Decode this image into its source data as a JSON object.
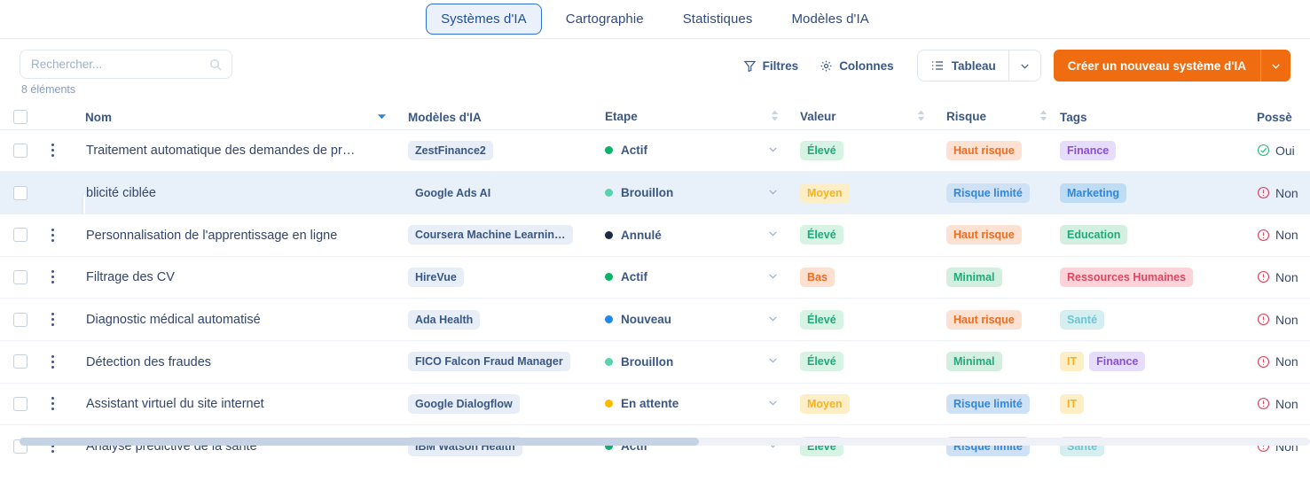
{
  "tabs": [
    {
      "label": "Systèmes d'IA",
      "active": true
    },
    {
      "label": "Cartographie",
      "active": false
    },
    {
      "label": "Statistiques",
      "active": false
    },
    {
      "label": "Modèles d'IA",
      "active": false
    }
  ],
  "toolbar": {
    "search_placeholder": "Rechercher...",
    "search_value": "",
    "count_label": "8 éléments",
    "filters_label": "Filtres",
    "columns_label": "Colonnes",
    "view_label": "Tableau",
    "create_label": "Créer un nouveau système d'IA",
    "accent_color": "#ef6c10"
  },
  "table": {
    "columns": [
      {
        "key": "nom",
        "label": "Nom",
        "sort": "desc"
      },
      {
        "key": "modeles",
        "label": "Modèles d'IA",
        "sort": "none"
      },
      {
        "key": "etape",
        "label": "Etape",
        "sort": "sortable"
      },
      {
        "key": "valeur",
        "label": "Valeur",
        "sort": "sortable"
      },
      {
        "key": "risque",
        "label": "Risque",
        "sort": "sortable"
      },
      {
        "key": "tags",
        "label": "Tags",
        "sort": "none"
      },
      {
        "key": "possede",
        "label": "Possè",
        "sort": "none"
      }
    ],
    "rows": [
      {
        "nom": "Traitement automatique des demandes de pr…",
        "modele": "ZestFinance2",
        "modele_pill": true,
        "etape": "Actif",
        "etape_color": "#09b36b",
        "valeur": "Élevé",
        "valeur_bg": "#d6f3e4",
        "valeur_fg": "#1fa97a",
        "risque": "Haut risque",
        "risque_bg": "#fde2d3",
        "risque_fg": "#ef6c20",
        "tags": [
          {
            "label": "Finance",
            "bg": "#e6dcfb",
            "fg": "#8a4fd8"
          }
        ],
        "possede": "Oui",
        "possede_state": "yes",
        "hovered": false
      },
      {
        "nom": "blicité ciblée",
        "modele": "Google Ads AI",
        "modele_pill": false,
        "etape": "Brouillon",
        "etape_color": "#58d3ae",
        "valeur": "Moyen",
        "valeur_bg": "#fdeec6",
        "valeur_fg": "#f4b223",
        "risque": "Risque limité",
        "risque_bg": "#cfe2f5",
        "risque_fg": "#2f86e0",
        "tags": [
          {
            "label": "Marketing",
            "bg": "#bfdcf5",
            "fg": "#2f86e0"
          }
        ],
        "possede": "Non",
        "possede_state": "no",
        "hovered": true
      },
      {
        "nom": "Personnalisation de l'apprentissage en ligne",
        "modele": "Coursera Machine Learnin…",
        "modele_pill": true,
        "etape": "Annulé",
        "etape_color": "#1d2b42",
        "valeur": "Élevé",
        "valeur_bg": "#d6f3e4",
        "valeur_fg": "#1fa97a",
        "risque": "Haut risque",
        "risque_bg": "#fde2d3",
        "risque_fg": "#ef6c20",
        "tags": [
          {
            "label": "Education",
            "bg": "#d3efe0",
            "fg": "#21a97a"
          }
        ],
        "possede": "Non",
        "possede_state": "no",
        "hovered": false
      },
      {
        "nom": "Filtrage des CV",
        "modele": "HireVue",
        "modele_pill": true,
        "etape": "Actif",
        "etape_color": "#09b36b",
        "valeur": "Bas",
        "valeur_bg": "#fde0cf",
        "valeur_fg": "#ef6c20",
        "risque": "Minimal",
        "risque_bg": "#d3efe0",
        "risque_fg": "#21a97a",
        "tags": [
          {
            "label": "Ressources Humaines",
            "bg": "#fbd3d8",
            "fg": "#e0455f"
          }
        ],
        "possede": "Non",
        "possede_state": "no",
        "hovered": false
      },
      {
        "nom": "Diagnostic médical automatisé",
        "modele": "Ada Health",
        "modele_pill": true,
        "etape": "Nouveau",
        "etape_color": "#1f87e8",
        "valeur": "Élevé",
        "valeur_bg": "#d6f3e4",
        "valeur_fg": "#1fa97a",
        "risque": "Haut risque",
        "risque_bg": "#fde2d3",
        "risque_fg": "#ef6c20",
        "tags": [
          {
            "label": "Santé",
            "bg": "#d5eef0",
            "fg": "#6ec5cf"
          }
        ],
        "possede": "Non",
        "possede_state": "no",
        "hovered": false
      },
      {
        "nom": "Détection des fraudes",
        "modele": "FICO Falcon Fraud Manager",
        "modele_pill": true,
        "etape": "Brouillon",
        "etape_color": "#58d3ae",
        "valeur": "Élevé",
        "valeur_bg": "#d6f3e4",
        "valeur_fg": "#1fa97a",
        "risque": "Minimal",
        "risque_bg": "#d3efe0",
        "risque_fg": "#21a97a",
        "tags": [
          {
            "label": "IT",
            "bg": "#fdeec6",
            "fg": "#f4b223"
          },
          {
            "label": "Finance",
            "bg": "#e6dcfb",
            "fg": "#8a4fd8"
          }
        ],
        "possede": "Non",
        "possede_state": "no",
        "hovered": false
      },
      {
        "nom": "Assistant virtuel du site internet",
        "modele": "Google Dialogflow",
        "modele_pill": true,
        "etape": "En attente",
        "etape_color": "#fcb900",
        "valeur": "Moyen",
        "valeur_bg": "#fdeec6",
        "valeur_fg": "#f4b223",
        "risque": "Risque limité",
        "risque_bg": "#cfe2f5",
        "risque_fg": "#2f86e0",
        "tags": [
          {
            "label": "IT",
            "bg": "#fdeec6",
            "fg": "#f4b223"
          }
        ],
        "possede": "Non",
        "possede_state": "no",
        "hovered": false
      },
      {
        "nom": "Analyse prédictive de la santé",
        "modele": "IBM Watson Health",
        "modele_pill": true,
        "etape": "Actif",
        "etape_color": "#09b36b",
        "valeur": "Élevé",
        "valeur_bg": "#d6f3e4",
        "valeur_fg": "#1fa97a",
        "risque": "Risque limité",
        "risque_bg": "#cfe2f5",
        "risque_fg": "#2f86e0",
        "tags": [
          {
            "label": "Santé",
            "bg": "#d5eef0",
            "fg": "#6ec5cf"
          }
        ],
        "possede": "Non",
        "possede_state": "no",
        "hovered": false
      }
    ]
  }
}
